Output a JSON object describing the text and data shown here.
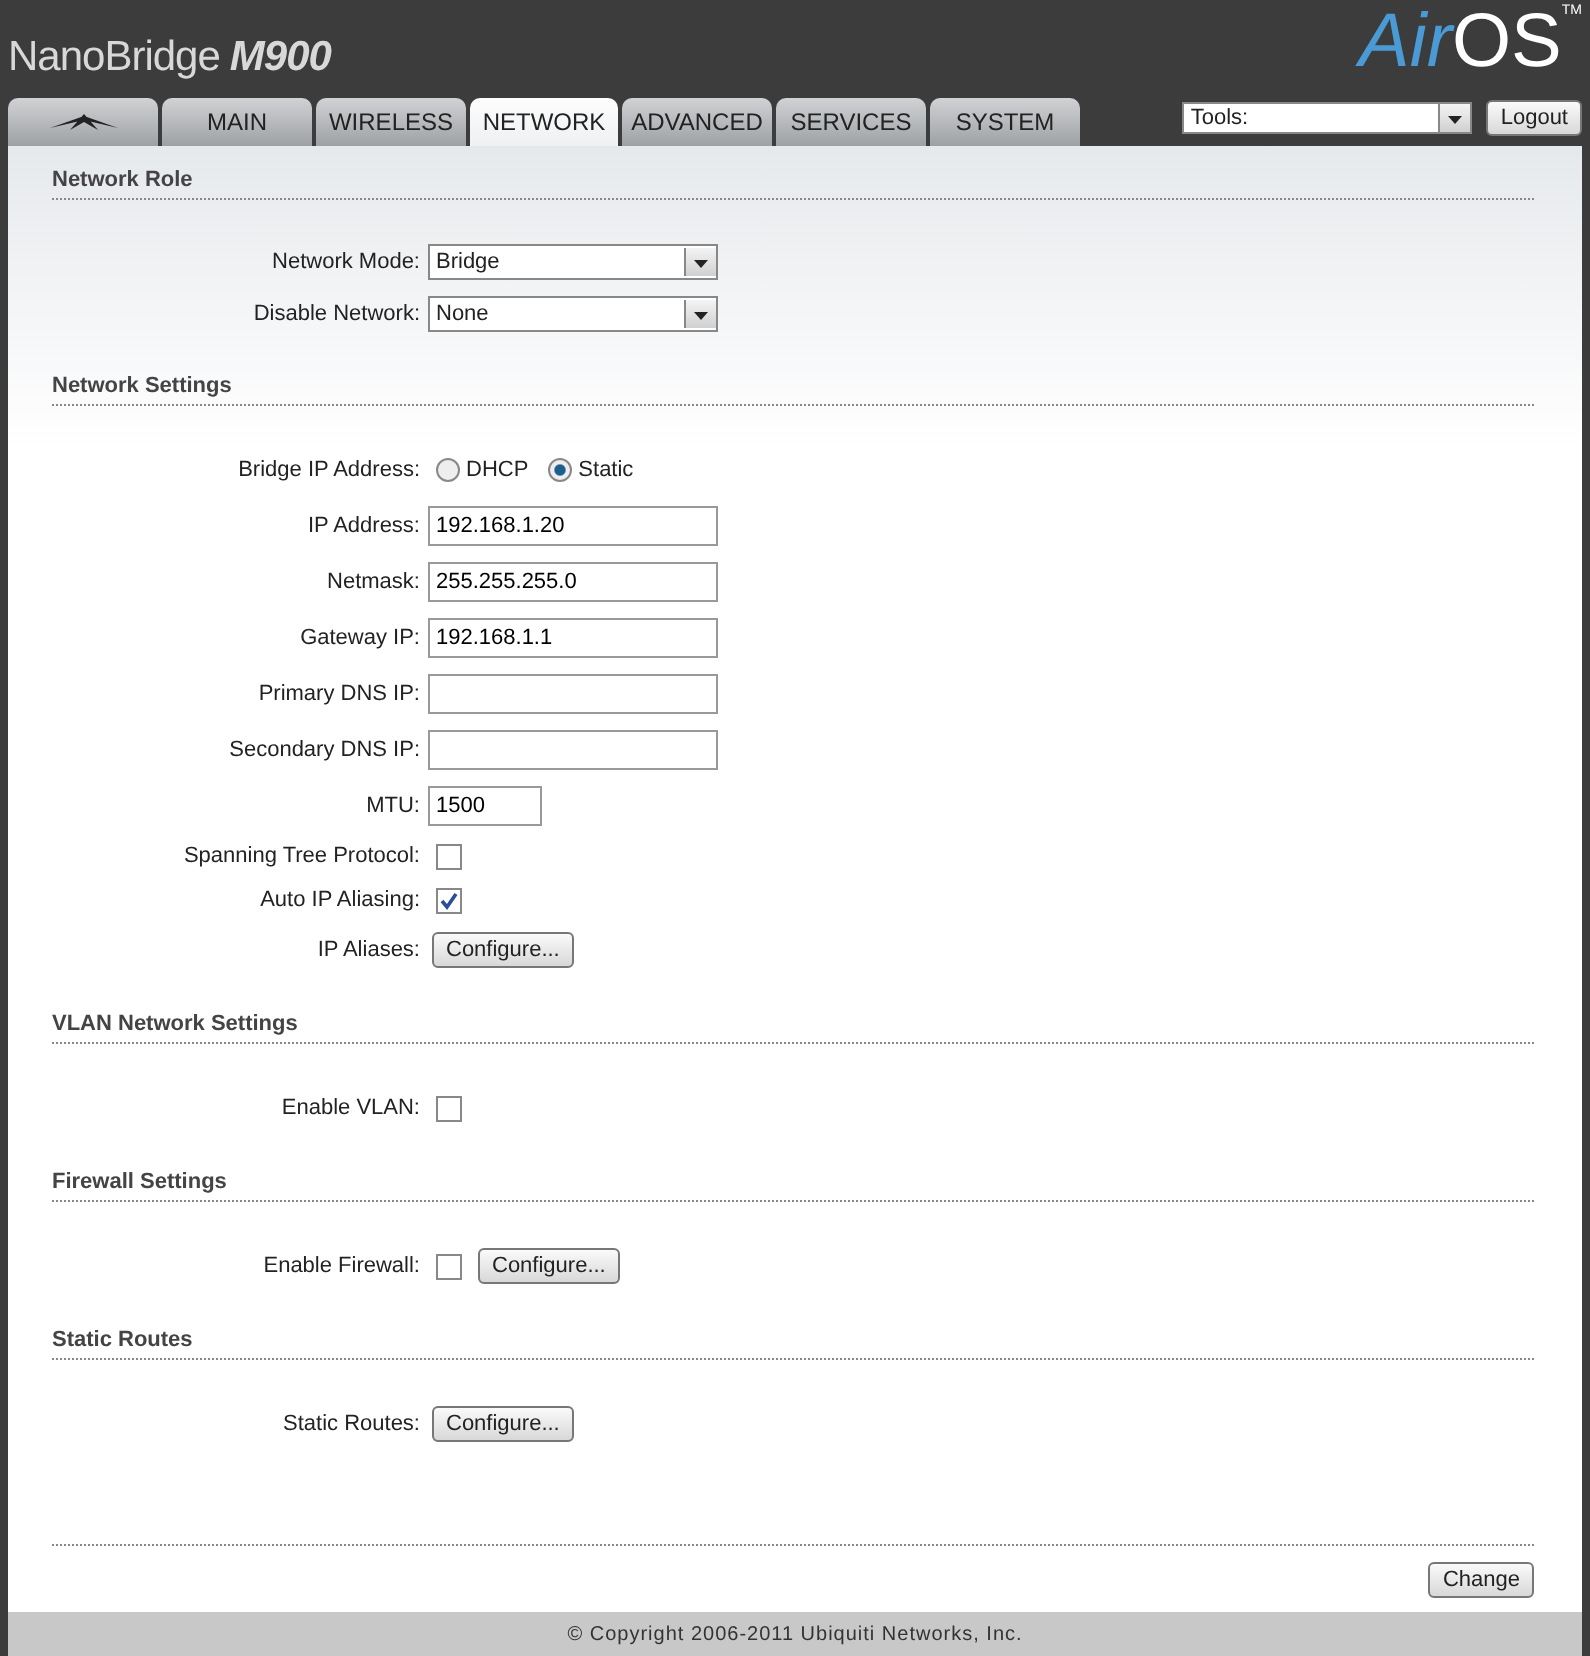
{
  "header": {
    "product": "NanoBridge",
    "model": "M900",
    "logo_a": "Air",
    "logo_b": "OS",
    "logo_tm": "TM"
  },
  "tabs": [
    {
      "kind": "logo",
      "selected": false
    },
    {
      "kind": "text",
      "label": "MAIN",
      "selected": false
    },
    {
      "kind": "text",
      "label": "WIRELESS",
      "selected": false
    },
    {
      "kind": "text",
      "label": "NETWORK",
      "selected": true
    },
    {
      "kind": "text",
      "label": "ADVANCED",
      "selected": false
    },
    {
      "kind": "text",
      "label": "SERVICES",
      "selected": false
    },
    {
      "kind": "text",
      "label": "SYSTEM",
      "selected": false
    }
  ],
  "tools": {
    "value": "Tools:"
  },
  "logout": "Logout",
  "sections": [
    {
      "title": "Network Role",
      "fields": [
        {
          "kind": "select",
          "label": "Network Mode:",
          "value": "Bridge"
        },
        {
          "kind": "select",
          "label": "Disable Network:",
          "value": "None"
        }
      ]
    },
    {
      "title": "Network Settings",
      "fields": [
        {
          "kind": "radio",
          "label": "Bridge IP Address:",
          "options": [
            {
              "label": "DHCP",
              "selected": false
            },
            {
              "label": "Static",
              "selected": true
            }
          ]
        },
        {
          "kind": "text",
          "label": "IP Address:",
          "value": "192.168.1.20"
        },
        {
          "kind": "text",
          "label": "Netmask:",
          "value": "255.255.255.0"
        },
        {
          "kind": "text",
          "label": "Gateway IP:",
          "value": "192.168.1.1"
        },
        {
          "kind": "text",
          "label": "Primary DNS IP:"
        },
        {
          "kind": "text",
          "label": "Secondary DNS IP:"
        },
        {
          "kind": "short_text",
          "label": "MTU:",
          "value": "1500"
        },
        {
          "kind": "checkbox",
          "label": "Spanning Tree Protocol:",
          "checked": false
        },
        {
          "kind": "checkbox",
          "label": "Auto IP Aliasing:",
          "checked": true
        },
        {
          "kind": "button",
          "label": "IP Aliases:",
          "button": "Configure..."
        }
      ]
    },
    {
      "title": "VLAN Network Settings",
      "fields": [
        {
          "kind": "checkbox",
          "label": "Enable VLAN:",
          "checked": false
        }
      ]
    },
    {
      "title": "Firewall Settings",
      "fields": [
        {
          "kind": "checkbox_button",
          "label": "Enable Firewall:",
          "checked": false,
          "button": "Configure..."
        }
      ]
    },
    {
      "title": "Static Routes",
      "fields": [
        {
          "kind": "button",
          "label": "Static Routes:",
          "button": "Configure..."
        }
      ]
    }
  ],
  "change": "Change",
  "footer": "© Copyright 2006-2011 Ubiquiti Networks, Inc."
}
